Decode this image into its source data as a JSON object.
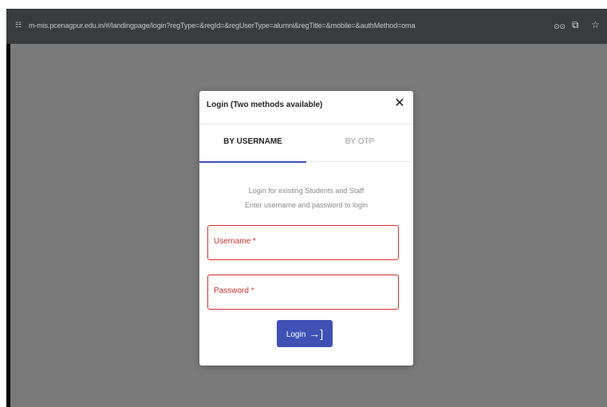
{
  "browser": {
    "url": "m-mis.pcenagpur.edu.in/#/landingpage/login?regType=&regId=&regUserType=alumni&regTitle=&mobile=&authMethod=oma",
    "site_icon": "☷",
    "icons": {
      "incognito": "⊙⊙",
      "install": "⧉",
      "bookmark": "☆"
    }
  },
  "modal": {
    "title": "Login (Two methods available)",
    "close": "✕",
    "tabs": [
      {
        "label": "BY USERNAME"
      },
      {
        "label": "BY OTP"
      }
    ],
    "description_line1": "Login for existing Students and Staff",
    "description_line2": "Enter username and password to login",
    "username_label": "Username *",
    "password_label": "Password *",
    "login_label": "Login",
    "login_icon": "→]"
  },
  "colors": {
    "accent": "#3f51b5",
    "error": "#d32f2f",
    "backdrop": "#7a7a7a"
  }
}
